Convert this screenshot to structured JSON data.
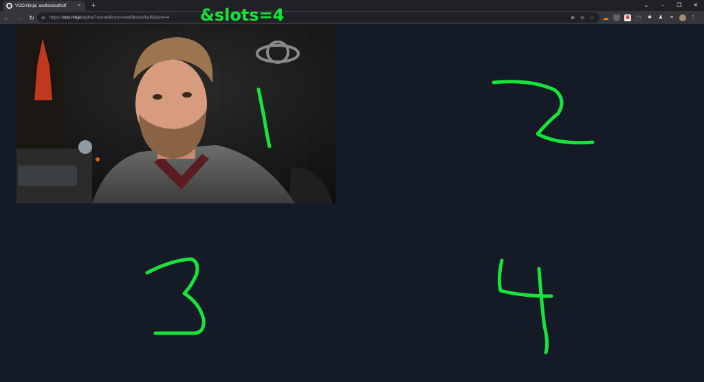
{
  "browser": {
    "tab": {
      "title": "VDO.Ninja: asdfasdsdfsdf",
      "close": "×"
    },
    "new_tab": "+",
    "window_buttons": {
      "tabs_menu": "⌄",
      "minimize": "–",
      "restore": "❐",
      "close": "✕"
    },
    "nav": {
      "back": "←",
      "forward": "→",
      "reload": "↻"
    },
    "address": {
      "scheme": "https://",
      "host": "vdo.ninja",
      "path": "/alpha/?scene&room=asdfasdsdfsdf&slots=4",
      "site_info_icon": "⊜"
    },
    "omnibox_icons": {
      "zoom": "⊕",
      "share": "⊙",
      "bookmark": "☆"
    },
    "extensions": {
      "cloud": "☁",
      "shield": "⛨",
      "red": "▣",
      "dots": "⋯",
      "puzzle": "✱",
      "flask": "♟",
      "list": "≡",
      "menu": "⋮"
    }
  },
  "overlay": {
    "param_text": "&slots=4",
    "color": "#17e43a"
  },
  "scene": {
    "background": "#141a26",
    "slots": [
      {
        "number": "1",
        "has_video": true
      },
      {
        "number": "2",
        "has_video": false
      },
      {
        "number": "3",
        "has_video": false
      },
      {
        "number": "4",
        "has_video": false
      }
    ]
  }
}
